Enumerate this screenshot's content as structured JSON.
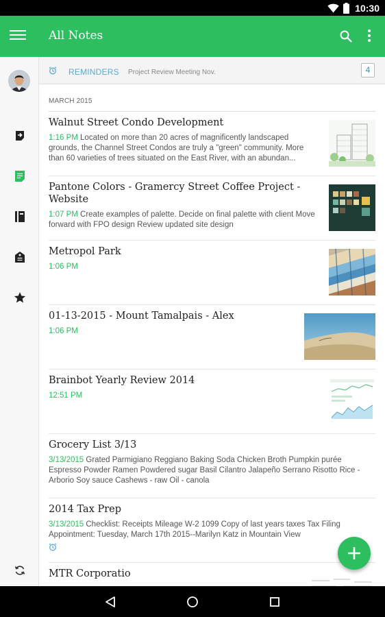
{
  "status_bar": {
    "time": "10:30",
    "icons": [
      "wifi-icon",
      "battery-icon"
    ]
  },
  "app_bar": {
    "title": "All Notes",
    "icons": [
      "menu-icon",
      "search-icon",
      "more-icon"
    ]
  },
  "side_rail": {
    "items": [
      "sync-icon",
      "notes-icon",
      "notebooks-icon",
      "tags-icon",
      "shortcuts-icon"
    ]
  },
  "reminders": {
    "label": "REMINDERS",
    "preview": "Project Review Meeting Nov.",
    "count": "4"
  },
  "section": {
    "header": "MARCH 2015"
  },
  "notes": [
    {
      "title": "Walnut Street Condo Development",
      "time": "1:16 PM",
      "snippet": "Located on more than 20 acres of magnificently landscaped grounds, the Channel Street Condos are truly a \"green\" community. More than 60 varieties of trees situated on the East River, with an abundan..."
    },
    {
      "title": "Pantone Colors - Gramercy Street Coffee Project - Website",
      "time": "1:07 PM",
      "snippet": "Create examples of palette. Decide on final palette with client Move forward with FPO design Review updated site design"
    },
    {
      "title": "Metropol Park",
      "time": "1:06 PM",
      "snippet": ""
    },
    {
      "title": "01-13-2015 - Mount Tamalpais - Alex",
      "time": "1:06 PM",
      "snippet": ""
    },
    {
      "title": "Brainbot Yearly Review 2014",
      "time": "12:51 PM",
      "snippet": ""
    },
    {
      "title": "Grocery List 3/13",
      "time": "3/13/2015",
      "snippet": "Grated Parmigiano Reggiano   Baking Soda   Chicken Broth   Pumpkin purée   Espresso Powder   Ramen   Powdered sugar   Basil   Cilantro   Jalapeño   Serrano   Risotto Rice - Arborio   Soy sauce   Cashews - raw   Oil - canola"
    },
    {
      "title": "2014 Tax Prep",
      "time": "3/13/2015",
      "snippet": "Checklist:  Receipts   Mileage   W-2   1099   Copy of last years taxes   Tax Filing Appointment: Tuesday, March 17th 2015--Marilyn Katz in Mountain View"
    },
    {
      "title": "MTR Corporatio",
      "time": "",
      "snippet": ""
    }
  ],
  "colors": {
    "accent": "#2DBE60",
    "reminder_blue": "#5AA9D8"
  }
}
